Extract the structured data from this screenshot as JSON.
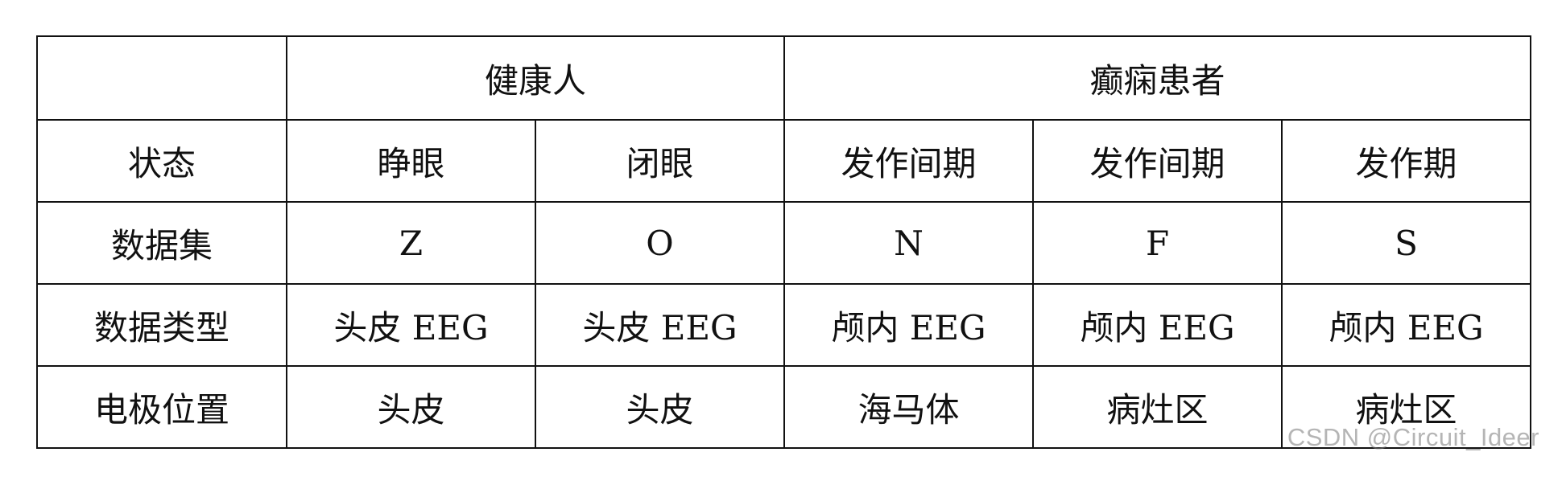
{
  "table": {
    "header": {
      "corner": "",
      "group_healthy": "健康人",
      "group_epilepsy": "癫痫患者"
    },
    "rows": [
      {
        "label": "状态",
        "cells": [
          "睁眼",
          "闭眼",
          "发作间期",
          "发作间期",
          "发作期"
        ]
      },
      {
        "label": "数据集",
        "cells": [
          "Z",
          "O",
          "N",
          "F",
          "S"
        ]
      },
      {
        "label": "数据类型",
        "cells": [
          "头皮 EEG",
          "头皮 EEG",
          "颅内 EEG",
          "颅内 EEG",
          "颅内 EEG"
        ]
      },
      {
        "label": "电极位置",
        "cells": [
          "头皮",
          "头皮",
          "海马体",
          "病灶区",
          "病灶区"
        ]
      }
    ]
  },
  "watermark": "CSDN @Circuit_Ideer"
}
